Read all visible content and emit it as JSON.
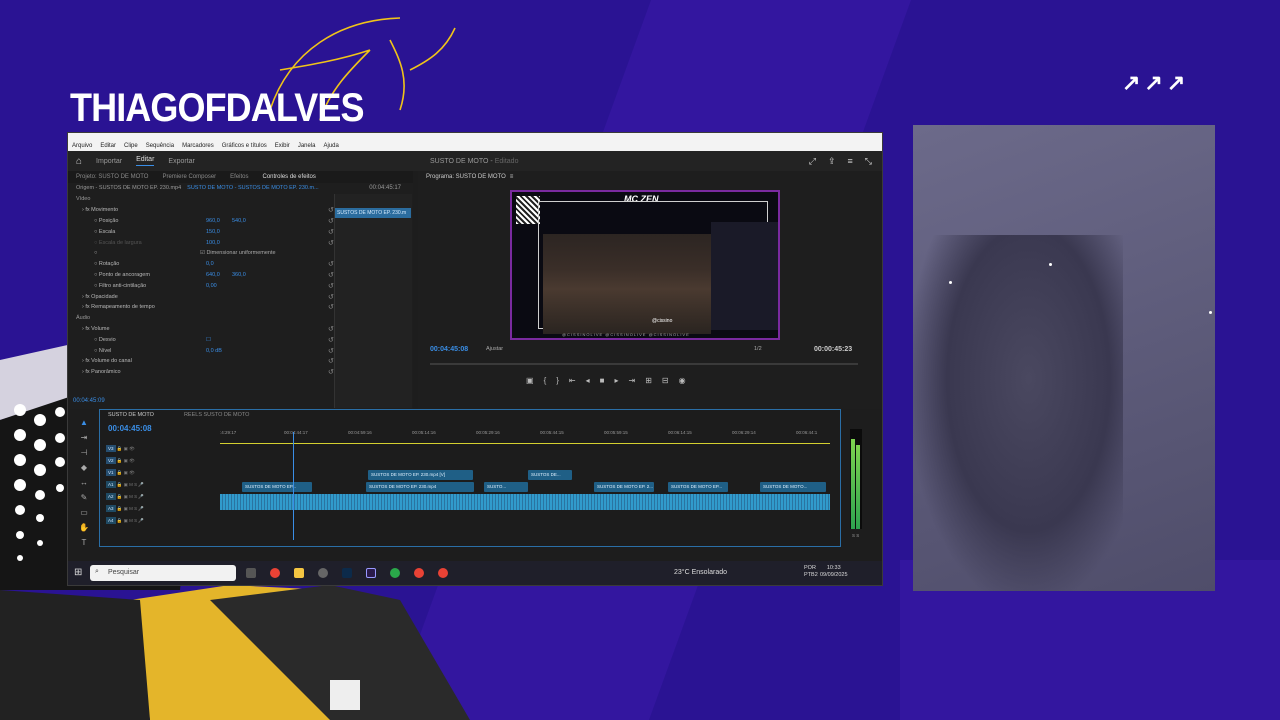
{
  "brand": {
    "name": "THIAGOFDALVES",
    "script": "Edits",
    "arrows": "↗↗↗"
  },
  "menu": [
    "Arquivo",
    "Editar",
    "Clipe",
    "Sequência",
    "Marcadores",
    "Gráficos e títulos",
    "Exibir",
    "Janela",
    "Ajuda"
  ],
  "workspace": {
    "tabs": [
      "Importar",
      "Editar",
      "Exportar"
    ],
    "active": "Editar",
    "project_name": "SUSTO DE MOTO",
    "project_status": "Editado"
  },
  "left_panel": {
    "tabs": [
      "Projeto: SUSTO DE MOTO",
      "Premiere Composer",
      "Efeitos",
      "Controles de efeitos"
    ],
    "source_label": "Origem - SUSTOS DE MOTO EP. 230.mp4",
    "sequence_label": "SUSTO DE MOTO - SUSTOS DE MOTO EP. 230.m...",
    "timecode_top": "00:04:45:17",
    "mini_clip": "SUSTOS DE MOTO EP. 230.m",
    "rows": [
      {
        "label": "Vídeo",
        "section": true
      },
      {
        "label": "Movimento",
        "fx": true
      },
      {
        "label": "Posição",
        "v1": "960,0",
        "v2": "540,0"
      },
      {
        "label": "Escala",
        "v1": "150,0"
      },
      {
        "label": "Escala de largura",
        "v1": "100,0",
        "dim": true
      },
      {
        "label": "",
        "check": "Dimensionar uniformemente"
      },
      {
        "label": "Rotação",
        "v1": "0,0"
      },
      {
        "label": "Ponto de ancoragem",
        "v1": "640,0",
        "v2": "360,0"
      },
      {
        "label": "Filtro anti-cintilação",
        "v1": "0,00"
      },
      {
        "label": "Opacidade",
        "fx": true
      },
      {
        "label": "Remapeamento de tempo",
        "fx": true
      },
      {
        "label": "Áudio",
        "section": true
      },
      {
        "label": "Volume",
        "fx": true
      },
      {
        "label": "Desvio",
        "v1": ""
      },
      {
        "label": "Nível",
        "v1": "0,0 dB"
      },
      {
        "label": "Volume do canal",
        "fx": true
      },
      {
        "label": "Panorâmico",
        "fx": true
      }
    ],
    "bottom_timecode": "00:04:45:09"
  },
  "program": {
    "title": "Programa: SUSTO DE MOTO",
    "overlay_title": "MC ZEN",
    "timecode": "00:04:45:08",
    "fit": "Ajustar",
    "quality": "1/2",
    "duration": "00:00:45:23",
    "brandmark": "@cissino",
    "footer": "@CISSINOLIVE   @CISSINOLIVE   @CISSINOLIVE"
  },
  "timeline": {
    "tabs": [
      "SUSTO DE MOTO",
      "REELS SUSTO DE MOTO"
    ],
    "timecode": "00:04:45:08",
    "ruler": [
      ":4:29:17",
      "00:04:44:17",
      "00:04:59:16",
      "00:05:14:16",
      "00:05:29:16",
      "00:05:44:15",
      "00:05:59:15",
      "00:06:14:15",
      "00:06:29:14",
      "00:06:44:1"
    ],
    "tracks": [
      "V3",
      "V2",
      "V1",
      "A1",
      "A2",
      "A3",
      "A4"
    ],
    "clips": [
      {
        "text": "SUSTOS DE MOTO EP. 230.mp4 [V]"
      },
      {
        "text": "SUSTOS DE..."
      },
      {
        "text": "SUSTOS DE MOTO EP..."
      },
      {
        "text": "SUSTOS DE MOTO EP. 230.mp4"
      },
      {
        "text": "SUSTO..."
      },
      {
        "text": "SUSTOS DE MOTO EP. 2..."
      },
      {
        "text": "SUSTOS DE MOTO EP..."
      },
      {
        "text": "SUSTOS DE MOTO..."
      }
    ],
    "meter_label": "S S"
  },
  "taskbar": {
    "search": "Pesquisar",
    "weather": "23°C  Ensolarado",
    "lang": "POR\nPTB2",
    "time": "10:33",
    "date": "09/09/2025"
  },
  "colors": {
    "accent": "#3a8ee6",
    "brand_bg": "#2a1393",
    "script": "#f0c419"
  }
}
